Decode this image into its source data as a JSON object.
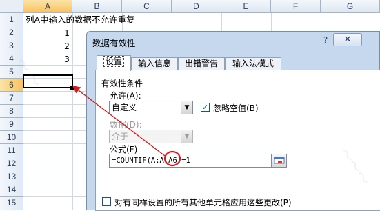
{
  "spreadsheet": {
    "columns": [
      "A",
      "B",
      "C",
      "D",
      "E",
      "F",
      "G"
    ],
    "rows": [
      "1",
      "2",
      "3",
      "4",
      "5",
      "6",
      "7",
      "8",
      "9",
      "10",
      "11",
      "12",
      "13",
      "14",
      "15"
    ],
    "selected_column": "A",
    "selected_row": "6",
    "cells": {
      "a1": "列A中输入的数据不允许重复",
      "a2": "1",
      "a3": "2",
      "a4": "3"
    }
  },
  "dialog": {
    "title": "数据有效性",
    "help_label": "?",
    "close_label": "✕",
    "tabs": [
      "设置",
      "输入信息",
      "出错警告",
      "输入法模式"
    ],
    "active_tab": 0,
    "section_title": "有效性条件",
    "allow_label": "允许(A):",
    "allow_value": "自定义",
    "ignore_blank_label": "忽略空值(B)",
    "ignore_blank_checked": true,
    "data_label": "数据(D):",
    "data_value": "介于",
    "formula_label": "公式(F)",
    "formula_value": "=COUNTIF(A:A,A6)=1",
    "apply_all_label": "对有同样设置的所有其他单元格应用这些更改(P)",
    "apply_all_checked": false
  },
  "annotation": {
    "highlighted_reference": "A6",
    "color": "#cc1f1f"
  }
}
